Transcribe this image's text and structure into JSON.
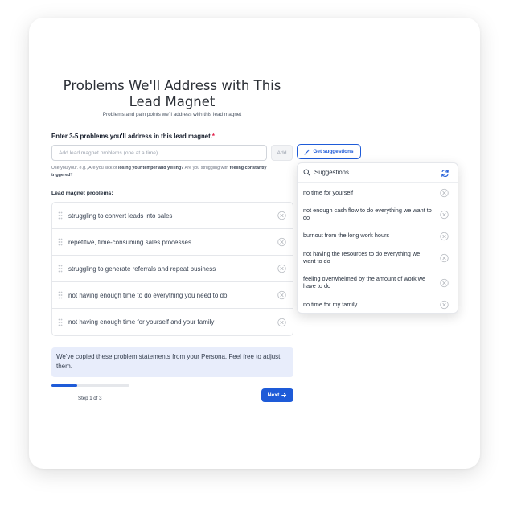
{
  "page": {
    "title": "Problems We'll Address with This Lead Magnet",
    "subtitle": "Problems and pain points we'll address with this lead magnet"
  },
  "form": {
    "label": "Enter 3-5 problems you'll address in this lead magnet.",
    "required_mark": "*",
    "input_placeholder": "Add lead magnet problems (one at a time)",
    "input_value": "",
    "add_label": "Add",
    "suggest_label": "Get suggestions",
    "hint_prefix": "Use you/your. e.g., Are you sick of ",
    "hint_bold1": "losing your temper and yelling?",
    "hint_mid": " Are you struggling with ",
    "hint_bold2": "feeling constantly triggered",
    "hint_suffix": "?"
  },
  "problems": {
    "label": "Lead magnet problems:",
    "items": [
      "struggling to convert leads into sales",
      "repetitive, time-consuming sales processes",
      "struggling to generate referrals and repeat business",
      "not having enough time to do everything you need to do",
      "not having enough time for yourself and your family"
    ]
  },
  "note": "We've copied these problem statements from your Persona. Feel free to adjust them.",
  "progress": {
    "step_label": "Step 1 of 3",
    "fraction": 0.333
  },
  "next_label": "Next",
  "suggestions": {
    "title": "Suggestions",
    "items": [
      "no time for yourself",
      "not enough cash flow to do everything we want to do",
      "burnout from the long work hours",
      "not having the resources to do everything we want to do",
      "feeling overwhelmed by the amount of work we have to do",
      "no time for my family"
    ]
  },
  "colors": {
    "accent": "#1e5bd8",
    "note_bg": "#e8edfb",
    "required": "#e11d48"
  },
  "icons": [
    "drag-handle-icon",
    "close-circle-icon",
    "magic-wand-icon",
    "search-icon",
    "refresh-icon",
    "arrow-right-icon"
  ]
}
